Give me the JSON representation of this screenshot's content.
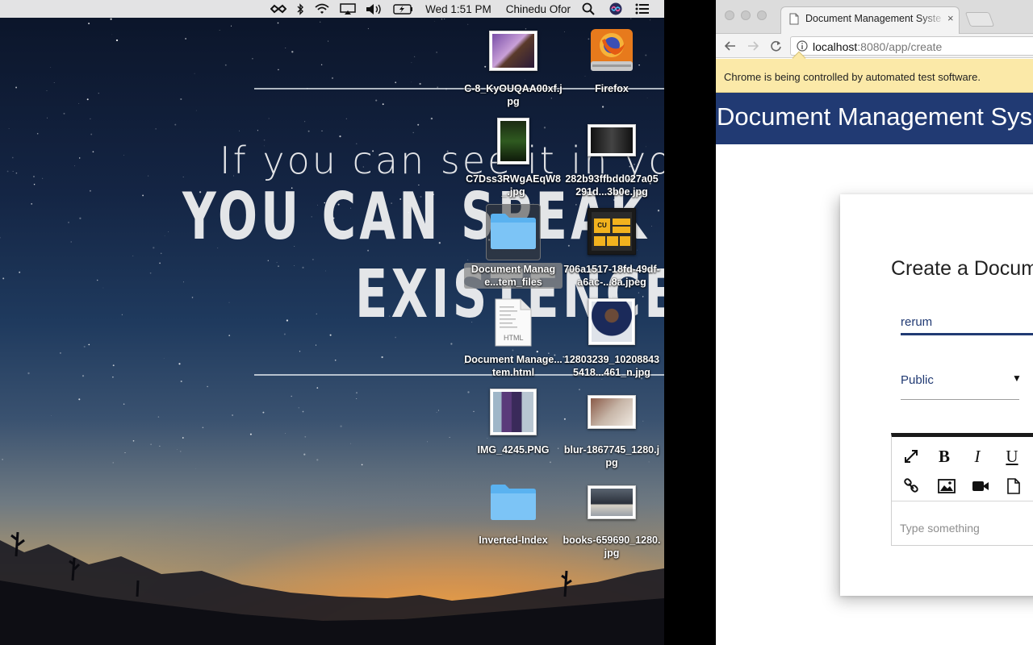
{
  "menubar": {
    "clock": "Wed 1:51 PM",
    "user": "Chinedu Ofor",
    "icons": [
      "infinity-icon",
      "bluetooth-icon",
      "wifi-icon",
      "airplay-icon",
      "volume-icon",
      "battery-icon",
      "spotlight-search-icon",
      "siri-icon",
      "notification-center-icon"
    ]
  },
  "wallpaper": {
    "line1": "If you can see it in you",
    "line2": "YOU CAN SPEAK I",
    "line3": "EXISTENCE"
  },
  "desktop": {
    "icons": [
      {
        "name": "C-8_KyOUQAA00xf.jpg",
        "kind": "photo",
        "selected": false
      },
      {
        "name": "Firefox",
        "kind": "app-drive",
        "selected": false
      },
      {
        "name": "C7Dss3RWgAEqW8_.jpg",
        "kind": "photo",
        "selected": false
      },
      {
        "name": "282b93ffbdd027a05291d...3b0e.jpg",
        "kind": "photo",
        "selected": false
      },
      {
        "name": "Document Manage...tem_files",
        "kind": "folder",
        "selected": true
      },
      {
        "name": "706a1517-18fd-49df-a6ac-...8a.jpeg",
        "kind": "photo",
        "selected": false
      },
      {
        "name": "Document Manage...tem.html",
        "kind": "html-file",
        "selected": false
      },
      {
        "name": "12803239_102088435418...461_n.jpg",
        "kind": "photo",
        "selected": false
      },
      {
        "name": "IMG_4245.PNG",
        "kind": "photo",
        "selected": false
      },
      {
        "name": "blur-1867745_1280.jpg",
        "kind": "photo",
        "selected": false
      },
      {
        "name": "Inverted-Index",
        "kind": "folder",
        "selected": false
      },
      {
        "name": "books-659690_1280.jpg",
        "kind": "photo",
        "selected": false
      }
    ],
    "html_badge": "HTML",
    "cu_badge": "CU"
  },
  "browser": {
    "tab_title": "Document Management Syste",
    "tab_close": "×",
    "url_host": "localhost",
    "url_path": ":8080/app/create",
    "infobar": "Chrome is being controlled by automated test software."
  },
  "app": {
    "title": "Document Management Sys",
    "form": {
      "heading": "Create a Docum",
      "title_value": "rerum",
      "access_value": "Public",
      "access_arrow": "▼",
      "editor_placeholder": "Type something",
      "toolbar": [
        "fullscreen-icon",
        "bold-icon",
        "italic-icon",
        "underline-icon",
        "link-icon",
        "image-icon",
        "video-icon",
        "file-icon"
      ],
      "bold_glyph": "B",
      "italic_glyph": "I",
      "underline_glyph": "U"
    }
  }
}
